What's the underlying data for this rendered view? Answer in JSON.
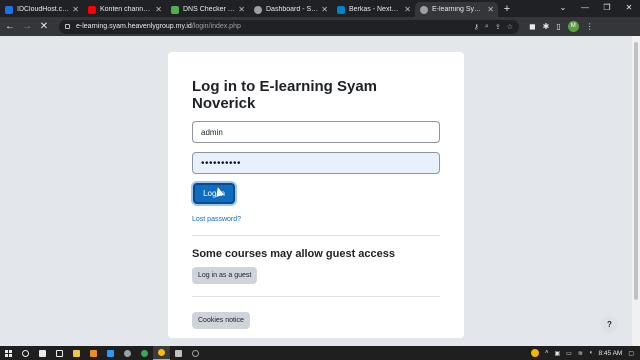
{
  "tabs": [
    {
      "title": "IDCloudHost.com",
      "color": "#1a73e8",
      "icon": "idcloudhost-favicon"
    },
    {
      "title": "Konten channel - Y",
      "color": "#ff0000",
      "icon": "youtube-favicon"
    },
    {
      "title": "DNS Checker - DN",
      "color": "#4caf50",
      "icon": "dnschecker-favicon"
    },
    {
      "title": "Dashboard - Syam",
      "color": "#9aa0a6",
      "icon": "globe-icon"
    },
    {
      "title": "Berkas - Nextcloud",
      "color": "#0082c9",
      "icon": "nextcloud-favicon"
    },
    {
      "title": "E-learning Syam N",
      "color": "#9aa0a6",
      "icon": "globe-icon"
    }
  ],
  "omnibox": {
    "host": "e-learning.syam.heavenlygroup.my.id",
    "path": "/login/index.php"
  },
  "profile": {
    "initial": "M"
  },
  "login": {
    "heading": "Log in to E-learning Syam Noverick",
    "username": "admin",
    "password_mask": "••••••••••",
    "login_button": "Log in",
    "lost_password": "Lost password?",
    "guest_heading": "Some courses may allow guest access",
    "guest_button": "Log in as a guest",
    "cookies_button": "Cookies notice",
    "help": "?"
  },
  "taskbar": {
    "clock": "8:45 AM",
    "apps": [
      {
        "icon": "search-icon",
        "color": "#e8eaed"
      },
      {
        "icon": "camera-icon",
        "color": "#e8eaed"
      },
      {
        "icon": "widgets-icon",
        "color": "#e8eaed"
      },
      {
        "icon": "file-explorer-icon",
        "color": "#f4c542"
      },
      {
        "icon": "app-orange-icon",
        "color": "#f08a24"
      },
      {
        "icon": "vscode-icon",
        "color": "#2b9af3"
      },
      {
        "icon": "settings-icon",
        "color": "#9aa0a6"
      },
      {
        "icon": "app-green-icon",
        "color": "#34a853"
      },
      {
        "icon": "chrome-icon",
        "color": "#fbbc04"
      },
      {
        "icon": "app-gray-icon",
        "color": "#bdc1c6"
      },
      {
        "icon": "app-circle-icon",
        "color": "#9aa0a6"
      }
    ]
  }
}
